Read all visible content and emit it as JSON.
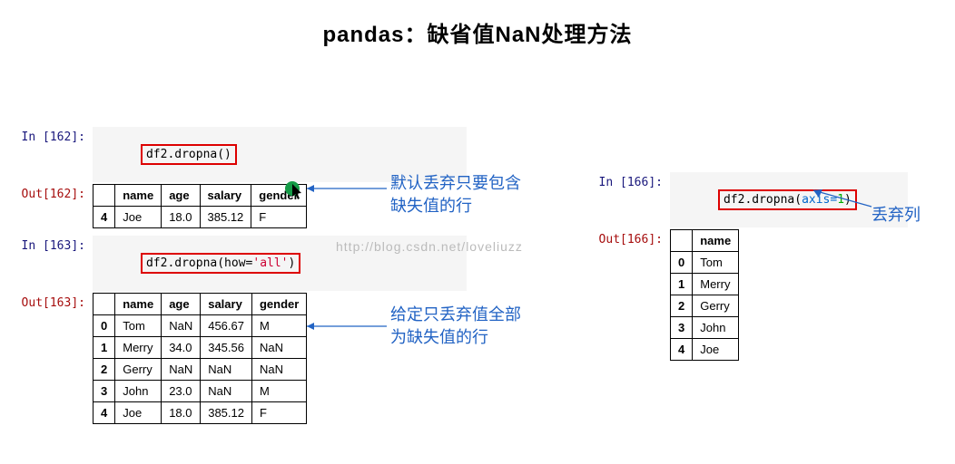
{
  "title": "pandas：缺省值NaN处理方法",
  "watermark": "http://blog.csdn.net/loveliuzz",
  "cell162": {
    "in_prompt": "In  [162]:",
    "out_prompt": "Out[162]:",
    "code": "df2.dropna()",
    "table": {
      "columns": [
        "name",
        "age",
        "salary",
        "gender"
      ],
      "index": [
        "4"
      ],
      "rows": [
        [
          "Joe",
          "18.0",
          "385.12",
          "F"
        ]
      ]
    }
  },
  "annot1": "默认丢弃只要包含\n缺失值的行",
  "cell163": {
    "in_prompt": "In  [163]:",
    "out_prompt": "Out[163]:",
    "code_plain": "df2.dropna(how=",
    "code_arg": "'all'",
    "code_tail": ")",
    "table": {
      "columns": [
        "name",
        "age",
        "salary",
        "gender"
      ],
      "index": [
        "0",
        "1",
        "2",
        "3",
        "4"
      ],
      "rows": [
        [
          "Tom",
          "NaN",
          "456.67",
          "M"
        ],
        [
          "Merry",
          "34.0",
          "345.56",
          "NaN"
        ],
        [
          "Gerry",
          "NaN",
          "NaN",
          "NaN"
        ],
        [
          "John",
          "23.0",
          "NaN",
          "M"
        ],
        [
          "Joe",
          "18.0",
          "385.12",
          "F"
        ]
      ]
    }
  },
  "annot2": "给定只丢弃值全部\n为缺失值的行",
  "cell166": {
    "in_prompt": "In  [166]:",
    "out_prompt": "Out[166]:",
    "code_plain": "df2.dropna(",
    "code_arg_key": "axis=",
    "code_arg_val": "1",
    "code_tail": ")",
    "table": {
      "columns": [
        "name"
      ],
      "index": [
        "0",
        "1",
        "2",
        "3",
        "4"
      ],
      "rows": [
        [
          "Tom"
        ],
        [
          "Merry"
        ],
        [
          "Gerry"
        ],
        [
          "John"
        ],
        [
          "Joe"
        ]
      ]
    }
  },
  "annot3": "丢弃列"
}
